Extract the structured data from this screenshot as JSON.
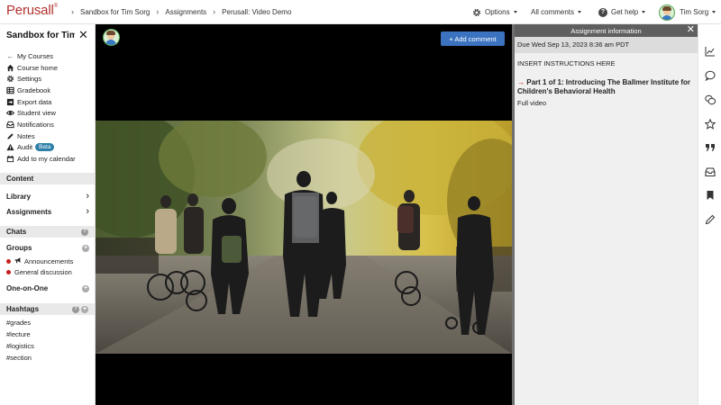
{
  "app": {
    "logo": "Perusall",
    "logo_mark": "®"
  },
  "breadcrumb": [
    "Sandbox for Tim Sorg",
    "Assignments",
    "Perusall: Video Demo"
  ],
  "topbar": {
    "options_label": "Options",
    "comments_label": "All comments",
    "help_label": "Get help",
    "user_name": "Tim Sorg"
  },
  "sidebar": {
    "course_title": "Sandbox for Tim Sorg",
    "menu": [
      {
        "icon": "arrow-left-icon",
        "label": "My Courses"
      },
      {
        "icon": "home-icon",
        "label": "Course home"
      },
      {
        "icon": "gear-icon",
        "label": "Settings"
      },
      {
        "icon": "gradebook-icon",
        "label": "Gradebook"
      },
      {
        "icon": "export-icon",
        "label": "Export data"
      },
      {
        "icon": "eye-icon",
        "label": "Student view"
      },
      {
        "icon": "inbox-icon",
        "label": "Notifications"
      },
      {
        "icon": "pencil-icon",
        "label": "Notes"
      },
      {
        "icon": "warning-icon",
        "label": "Audit",
        "badge": "Beta"
      },
      {
        "icon": "calendar-icon",
        "label": "Add to my calendar"
      }
    ],
    "content_header": "Content",
    "library_label": "Library",
    "assignments_label": "Assignments",
    "chats_header": "Chats",
    "groups_label": "Groups",
    "announcements_label": "Announcements",
    "general_label": "General discussion",
    "one_on_one_label": "One-on-One",
    "hashtags_header": "Hashtags",
    "hashtags": [
      "#grades",
      "#lecture",
      "#logistics",
      "#section"
    ]
  },
  "video": {
    "add_comment_label": "+ Add comment"
  },
  "panel": {
    "header": "Assignment information",
    "due": "Due Wed Sep 13, 2023 8:36 am PDT",
    "instructions": "INSERT INSTRUCTIONS HERE",
    "part_arrow": "→",
    "part_title": "Part 1 of 1: Introducing The Ballmer Institute for Children's Behavioral Health",
    "part_detail": "Full video"
  },
  "rail": [
    "chart-icon",
    "comment-icon",
    "comments-icon",
    "star-icon",
    "quote-icon",
    "inbox-icon",
    "bookmark-icon",
    "pencil-icon"
  ],
  "colors": {
    "brand": "#b3332e",
    "accent": "#3b73c0",
    "badge": "#2f7fa8",
    "alert": "#c41e1e"
  }
}
